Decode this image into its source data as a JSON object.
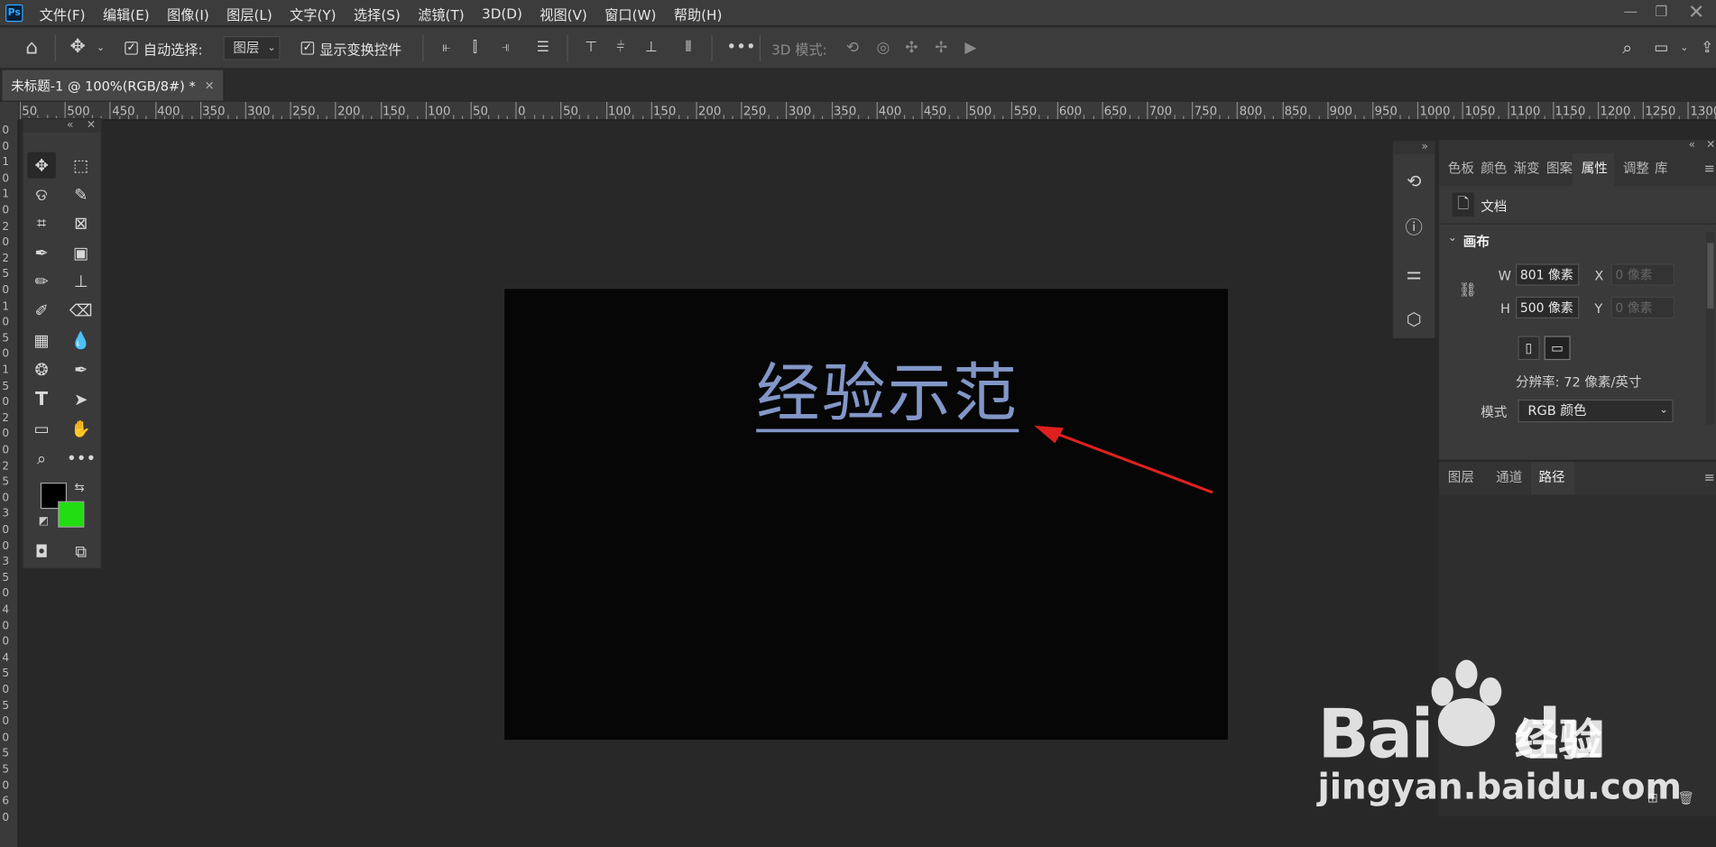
{
  "app": {
    "logo_text": "Ps"
  },
  "menu": [
    "文件(F)",
    "编辑(E)",
    "图像(I)",
    "图层(L)",
    "文字(Y)",
    "选择(S)",
    "滤镜(T)",
    "3D(D)",
    "视图(V)",
    "窗口(W)",
    "帮助(H)"
  ],
  "options": {
    "auto_select_label": "自动选择:",
    "auto_select_checked": true,
    "auto_select_target": "图层",
    "show_transform_label": "显示变换控件",
    "show_transform_checked": true,
    "mode3d_label": "3D 模式:"
  },
  "document": {
    "tab_title": "未标题-1 @ 100%(RGB/8#) *"
  },
  "ruler": {
    "h_labels": [
      "50",
      "500",
      "450",
      "400",
      "350",
      "300",
      "250",
      "200",
      "150",
      "100",
      "50",
      "0",
      "50",
      "100",
      "150",
      "200",
      "250",
      "300",
      "350",
      "400",
      "450",
      "500",
      "550",
      "600",
      "650",
      "700",
      "750",
      "800",
      "850",
      "900",
      "950",
      "1000",
      "1050",
      "1100",
      "1150",
      "1200",
      "1250",
      "1300"
    ],
    "v_labels": [
      "0",
      "0",
      "1",
      "0",
      "1",
      "0",
      "2",
      "0",
      "2",
      "5",
      "0",
      "1",
      "0",
      "5",
      "0",
      "1",
      "5",
      "0",
      "2",
      "0",
      "0",
      "2",
      "5",
      "0",
      "3",
      "0",
      "0",
      "3",
      "5",
      "0",
      "4",
      "0",
      "0",
      "4",
      "5",
      "0",
      "5",
      "0",
      "0",
      "5",
      "5",
      "0",
      "6",
      "0"
    ]
  },
  "canvas": {
    "text": "经验示范",
    "text_color": "#8296c8",
    "background": "#060606"
  },
  "colors": {
    "foreground": "#000000",
    "background": "#22dd11",
    "arrow": "#e02020"
  },
  "properties": {
    "tabs": [
      "色板",
      "颜色",
      "渐变",
      "图案",
      "属性",
      "调整",
      "库"
    ],
    "active_tab": "属性",
    "section_doc": "文档",
    "section_canvas": "画布",
    "w_label": "W",
    "w_value": "801 像素",
    "h_label": "H",
    "h_value": "500 像素",
    "x_label": "X",
    "x_value": "0 像素",
    "y_label": "Y",
    "y_value": "0 像素",
    "resolution": "分辨率: 72 像素/英寸",
    "mode_label": "模式",
    "mode_value": "RGB 颜色"
  },
  "layers_panel": {
    "tabs": [
      "图层",
      "通道",
      "路径"
    ],
    "active_tab": "路径"
  },
  "watermark": {
    "brand": "Bai",
    "brand2": "du",
    "suffix": "经验",
    "url": "jingyan.baidu.com"
  }
}
